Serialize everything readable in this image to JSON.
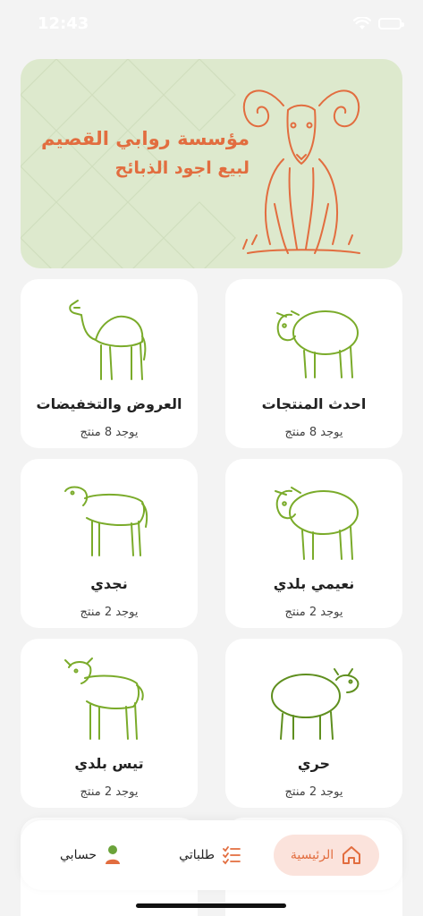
{
  "status_bar": {
    "time": "12:43"
  },
  "banner": {
    "line1": "مؤسسة روابي القصيم",
    "line2": "لبيع اجود الذبائح",
    "accent_color": "#e26d3f",
    "background_color": "#dde9cd"
  },
  "categories": [
    {
      "title": "احدث المنتجات",
      "count": "يوجد 8 منتج",
      "icon": "sheep-icon"
    },
    {
      "title": "العروض والتخفيضات",
      "count": "يوجد 8 منتج",
      "icon": "camel-icon"
    },
    {
      "title": "نعيمي بلدي",
      "count": "يوجد 2 منتج",
      "icon": "sheep-icon"
    },
    {
      "title": "نجدي",
      "count": "يوجد 2 منتج",
      "icon": "sheep-icon"
    },
    {
      "title": "حري",
      "count": "يوجد 2 منتج",
      "icon": "sheep-icon"
    },
    {
      "title": "تيس بلدي",
      "count": "يوجد 2 منتج",
      "icon": "goat-icon"
    }
  ],
  "nav": {
    "home_label": "الرئيسية",
    "orders_label": "طلباتي",
    "account_label": "حسابي",
    "active_color": "#e26d3f"
  }
}
